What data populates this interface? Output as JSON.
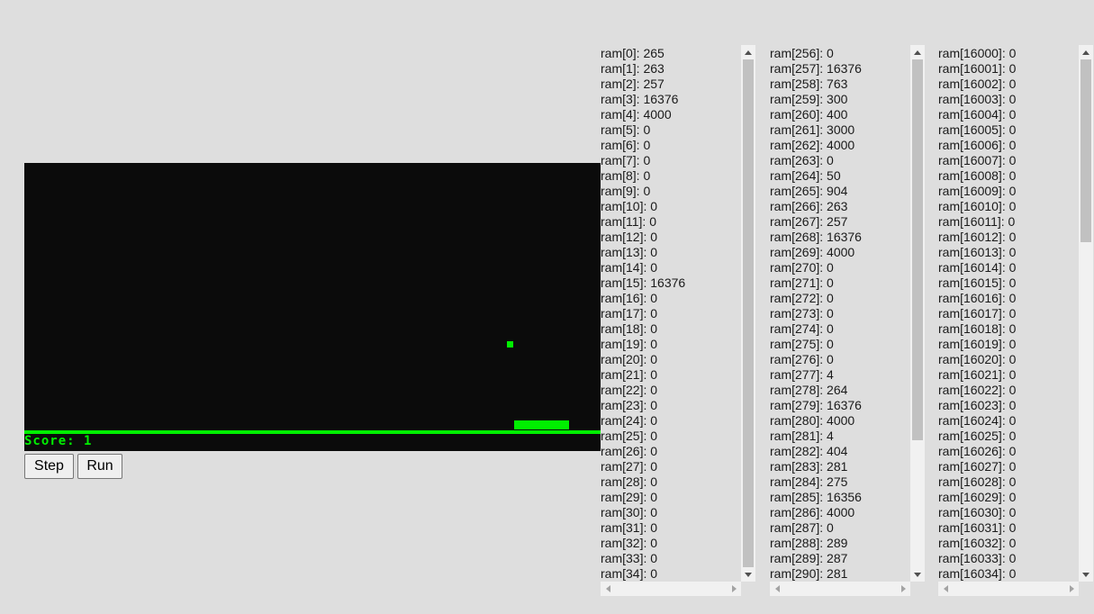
{
  "game": {
    "score_text": "Score: 1",
    "colors": {
      "background": "#0b0b0b",
      "foreground": "#00f000"
    }
  },
  "controls": {
    "step_label": "Step",
    "run_label": "Run"
  },
  "ram": {
    "panels": [
      {
        "rows": [
          "ram[0]: 265",
          "ram[1]: 263",
          "ram[2]: 257",
          "ram[3]: 16376",
          "ram[4]: 4000",
          "ram[5]: 0",
          "ram[6]: 0",
          "ram[7]: 0",
          "ram[8]: 0",
          "ram[9]: 0",
          "ram[10]: 0",
          "ram[11]: 0",
          "ram[12]: 0",
          "ram[13]: 0",
          "ram[14]: 0",
          "ram[15]: 16376",
          "ram[16]: 0",
          "ram[17]: 0",
          "ram[18]: 0",
          "ram[19]: 0",
          "ram[20]: 0",
          "ram[21]: 0",
          "ram[22]: 0",
          "ram[23]: 0",
          "ram[24]: 0",
          "ram[25]: 0",
          "ram[26]: 0",
          "ram[27]: 0",
          "ram[28]: 0",
          "ram[29]: 0",
          "ram[30]: 0",
          "ram[31]: 0",
          "ram[32]: 0",
          "ram[33]: 0",
          "ram[34]: 0"
        ],
        "scroll_fraction": 0.0,
        "thumb_fraction": 1.0
      },
      {
        "rows": [
          "ram[256]: 0",
          "ram[257]: 16376",
          "ram[258]: 763",
          "ram[259]: 300",
          "ram[260]: 400",
          "ram[261]: 3000",
          "ram[262]: 4000",
          "ram[263]: 0",
          "ram[264]: 50",
          "ram[265]: 904",
          "ram[266]: 263",
          "ram[267]: 257",
          "ram[268]: 16376",
          "ram[269]: 4000",
          "ram[270]: 0",
          "ram[271]: 0",
          "ram[272]: 0",
          "ram[273]: 0",
          "ram[274]: 0",
          "ram[275]: 0",
          "ram[276]: 0",
          "ram[277]: 4",
          "ram[278]: 264",
          "ram[279]: 16376",
          "ram[280]: 4000",
          "ram[281]: 4",
          "ram[282]: 404",
          "ram[283]: 281",
          "ram[284]: 275",
          "ram[285]: 16356",
          "ram[286]: 4000",
          "ram[287]: 0",
          "ram[288]: 289",
          "ram[289]: 287",
          "ram[290]: 281"
        ],
        "scroll_fraction": 0.0,
        "thumb_fraction": 0.75
      },
      {
        "rows": [
          "ram[16000]: 0",
          "ram[16001]: 0",
          "ram[16002]: 0",
          "ram[16003]: 0",
          "ram[16004]: 0",
          "ram[16005]: 0",
          "ram[16006]: 0",
          "ram[16007]: 0",
          "ram[16008]: 0",
          "ram[16009]: 0",
          "ram[16010]: 0",
          "ram[16011]: 0",
          "ram[16012]: 0",
          "ram[16013]: 0",
          "ram[16014]: 0",
          "ram[16015]: 0",
          "ram[16016]: 0",
          "ram[16017]: 0",
          "ram[16018]: 0",
          "ram[16019]: 0",
          "ram[16020]: 0",
          "ram[16021]: 0",
          "ram[16022]: 0",
          "ram[16023]: 0",
          "ram[16024]: 0",
          "ram[16025]: 0",
          "ram[16026]: 0",
          "ram[16027]: 0",
          "ram[16028]: 0",
          "ram[16029]: 0",
          "ram[16030]: 0",
          "ram[16031]: 0",
          "ram[16032]: 0",
          "ram[16033]: 0",
          "ram[16034]: 0"
        ],
        "scroll_fraction": 0.0,
        "thumb_fraction": 0.36
      }
    ]
  }
}
